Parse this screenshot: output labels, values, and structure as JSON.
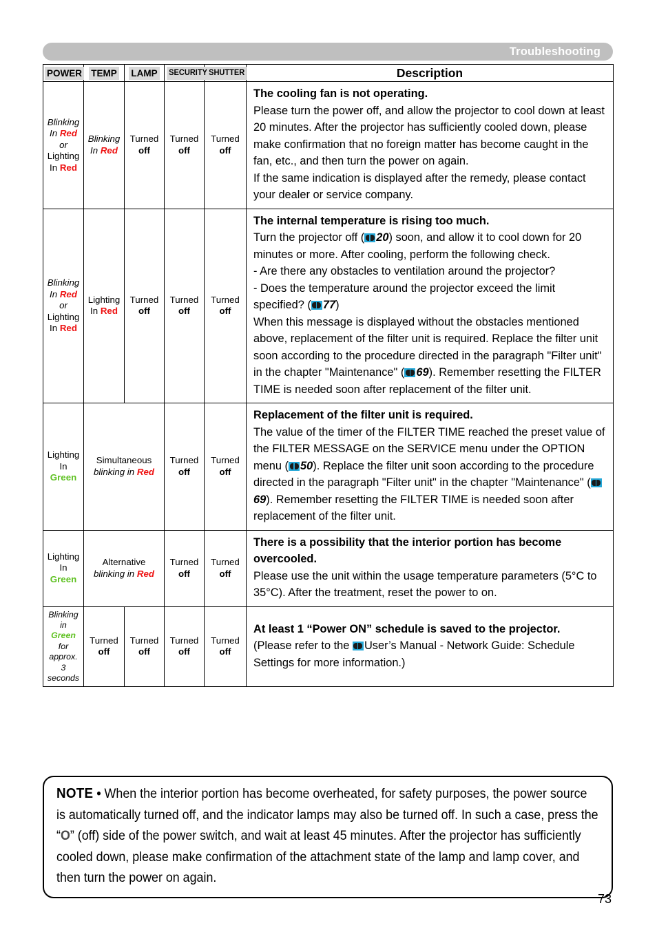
{
  "header": {
    "running_title": "Troubleshooting"
  },
  "table": {
    "columns": [
      {
        "label": "POWER",
        "icon": "power-indicator-header"
      },
      {
        "label": "TEMP",
        "icon": "temp-indicator-header"
      },
      {
        "label": "SECURITY",
        "icon": "security-indicator-header"
      },
      {
        "label": "LAMP",
        "icon": "lamp-indicator-header"
      },
      {
        "label": "SHUTTER",
        "icon": "shutter-indicator-header"
      },
      {
        "label": "Description",
        "icon": "description-header"
      }
    ],
    "column_labels": {
      "power": "POWER",
      "temp": "TEMP",
      "lamp": "LAMP",
      "security": "SECURITY",
      "shutter": "SHUTTER",
      "description": "Description"
    },
    "rows": [
      {
        "power": {
          "line1": "Blinking",
          "line2": "In",
          "state1": "Red",
          "or": "or",
          "line3": "Lighting",
          "line4": "In",
          "state2": "Red"
        },
        "temp": {
          "line1": "Blinking",
          "line2": "In",
          "state1": "Red"
        },
        "lamp": {
          "line1": "Turned",
          "line2": "off"
        },
        "security": {
          "line1": "Turned",
          "line2": "off"
        },
        "shutter": {
          "line1": "Turned",
          "line2": "off"
        },
        "heading": "The cooling fan is not operating.",
        "body": "Please turn the power off, and allow the projector to cool down at least 20 minutes. After the projector has sufficiently cooled down, please make confirmation that no foreign matter has become caught in the fan, etc., and then turn the power on again.\nIf the same indication is displayed after the remedy, please contact your dealer or service company."
      },
      {
        "power": {
          "line1": "Blinking",
          "line2": "In",
          "state1": "Red",
          "or": "or",
          "line3": "Lighting",
          "line4": "In",
          "state2": "Red"
        },
        "temp": {
          "line1": "Lighting",
          "line2": "In",
          "state1": "Red"
        },
        "lamp": {
          "line1": "Turned",
          "line2": "off"
        },
        "security": {
          "line1": "Turned",
          "line2": "off"
        },
        "shutter": {
          "line1": "Turned",
          "line2": "off"
        },
        "heading": "The internal temperature is rising too much.",
        "body_part1": "Turn the projector off (",
        "ref1": "20",
        "body_part2": ") soon, and allow it to cool down for 20 minutes or more. After cooling, perform the following check.\n- Are there any obstacles to ventilation around the projector?\n- Does the temperature around the projector exceed the limit specified? (",
        "ref2": "77",
        "body_part3": ")\nWhen this message is displayed without the obstacles mentioned above, replacement of the filter unit is required. Replace the filter unit soon according to the procedure directed in the paragraph \"Filter unit\" in the chapter \"Maintenance\" (",
        "ref3": "69",
        "body_part4": "). Remember resetting the FILTER TIME is needed soon after replacement of the filter unit."
      },
      {
        "power": {
          "line1": "Lighting",
          "line2": "In",
          "state1": "Green"
        },
        "temp_lamp": {
          "line1": "Simultaneous",
          "line2": "blinking in",
          "state1": "Red"
        },
        "security": {
          "line1": "Turned",
          "line2": "off"
        },
        "shutter": {
          "line1": "Turned",
          "line2": "off"
        },
        "heading": "Replacement of the filter unit is required.",
        "body_part1": "The value of the timer of the FILTER TIME reached the preset value of the FILTER MESSAGE on the SERVICE menu under the OPTION menu (",
        "ref1": "50",
        "body_part2": ").  Replace the filter unit soon according to the procedure directed in the paragraph \"Filter unit\" in the chapter \"Maintenance\" (",
        "ref2": "69",
        "body_part3": "). Remember resetting the FILTER TIME is needed soon after replacement of the filter unit."
      },
      {
        "power": {
          "line1": "Lighting",
          "line2": "In",
          "state1": "Green"
        },
        "temp_lamp": {
          "line1": "Alternative",
          "line2": "blinking in",
          "state1": "Red"
        },
        "security": {
          "line1": "Turned",
          "line2": "off"
        },
        "shutter": {
          "line1": "Turned",
          "line2": "off"
        },
        "heading": "There is a possibility that the interior portion has become overcooled.",
        "body": "Please use the unit within the usage temperature parameters (5°C to 35°C). After the treatment, reset the power to on."
      },
      {
        "power": {
          "line1": "Blinking",
          "line2": "in",
          "state1": "Green",
          "line3": "for",
          "line4": "approx.",
          "line5": "3",
          "line6": "seconds"
        },
        "temp": {
          "line1": "Turned",
          "line2": "off"
        },
        "lamp": {
          "line1": "Turned",
          "line2": "off"
        },
        "security": {
          "line1": "Turned",
          "line2": "off"
        },
        "shutter": {
          "line1": "Turned",
          "line2": "off"
        },
        "heading": "At least 1 “Power ON” schedule is saved to the projector.",
        "body_part1": "(Please refer to the ",
        "body_part2": "User’s Manual - Network Guide: Schedule Settings for more information.)"
      }
    ]
  },
  "note": {
    "label": "NOTE",
    "bullet": "•",
    "text_part1": "When the interior portion has become overheated, for safety purposes, the power source is automatically turned off, and the indicator lamps may also be turned off. In such a case, press the “",
    "power_symbol": "O",
    "text_part2": "” (off) side of the power switch, and wait at least 45 minutes. After the projector has sufficiently cooled down, please make confirmation of the attachment state of the lamp and lamp cover, and then turn the power on again."
  },
  "page_number": "73",
  "colors": {
    "red": "#ee1111",
    "green": "#5fc122",
    "header_bar": "#bfbfbf",
    "book_icon": "#25a8d8"
  }
}
